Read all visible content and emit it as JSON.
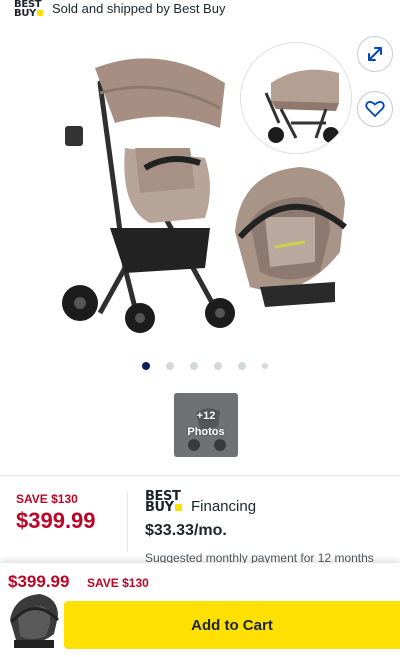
{
  "seller": {
    "logo_text": "BEST BUY",
    "text": "Sold and shipped by Best Buy"
  },
  "gallery": {
    "dot_count": 6,
    "active_index": 0,
    "more_photos": {
      "plus": "+12",
      "label": "Photos"
    },
    "expand_icon": "expand-arrows-icon",
    "favorite_icon": "heart-icon"
  },
  "pricing": {
    "save_label": "SAVE $130",
    "price": "$399.99"
  },
  "financing": {
    "logo_text": "BEST BUY",
    "title": "Financing",
    "amount": "$33.33/mo.",
    "note": "Suggested monthly payment for 12 months"
  },
  "sticky": {
    "price": "$399.99",
    "save_label": "SAVE $130",
    "cart_label": "Add to Cart"
  },
  "colors": {
    "brand_yellow": "#ffe000",
    "sale_red": "#bb0628",
    "dot_active": "#0a1e5a"
  }
}
